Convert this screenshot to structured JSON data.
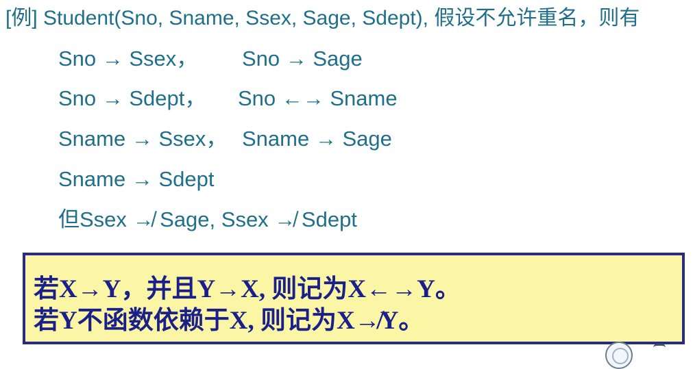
{
  "example": {
    "intro": "[例] Student(Sno, Sname, Ssex, Sage, Sdept), 假设不允许重名，则有"
  },
  "rules": [
    {
      "left": "Sno → Ssex，",
      "right": "Sno → Sage"
    },
    {
      "left": "Sno → Sdept，",
      "right": "Sno ←→ Sname"
    },
    {
      "left": "Sname → Ssex，",
      "right": "Sname → Sage"
    },
    {
      "left": "Sname → Sdept",
      "right": ""
    },
    {
      "left": "但Ssex ↛ Sage, Ssex ↛ Sdept",
      "right": ""
    }
  ],
  "notice": {
    "line1": "若X→Y，并且Y→X, 则记为X←→Y。",
    "line2": "若Y不函数依赖于X, 则记为X↛Y。"
  }
}
